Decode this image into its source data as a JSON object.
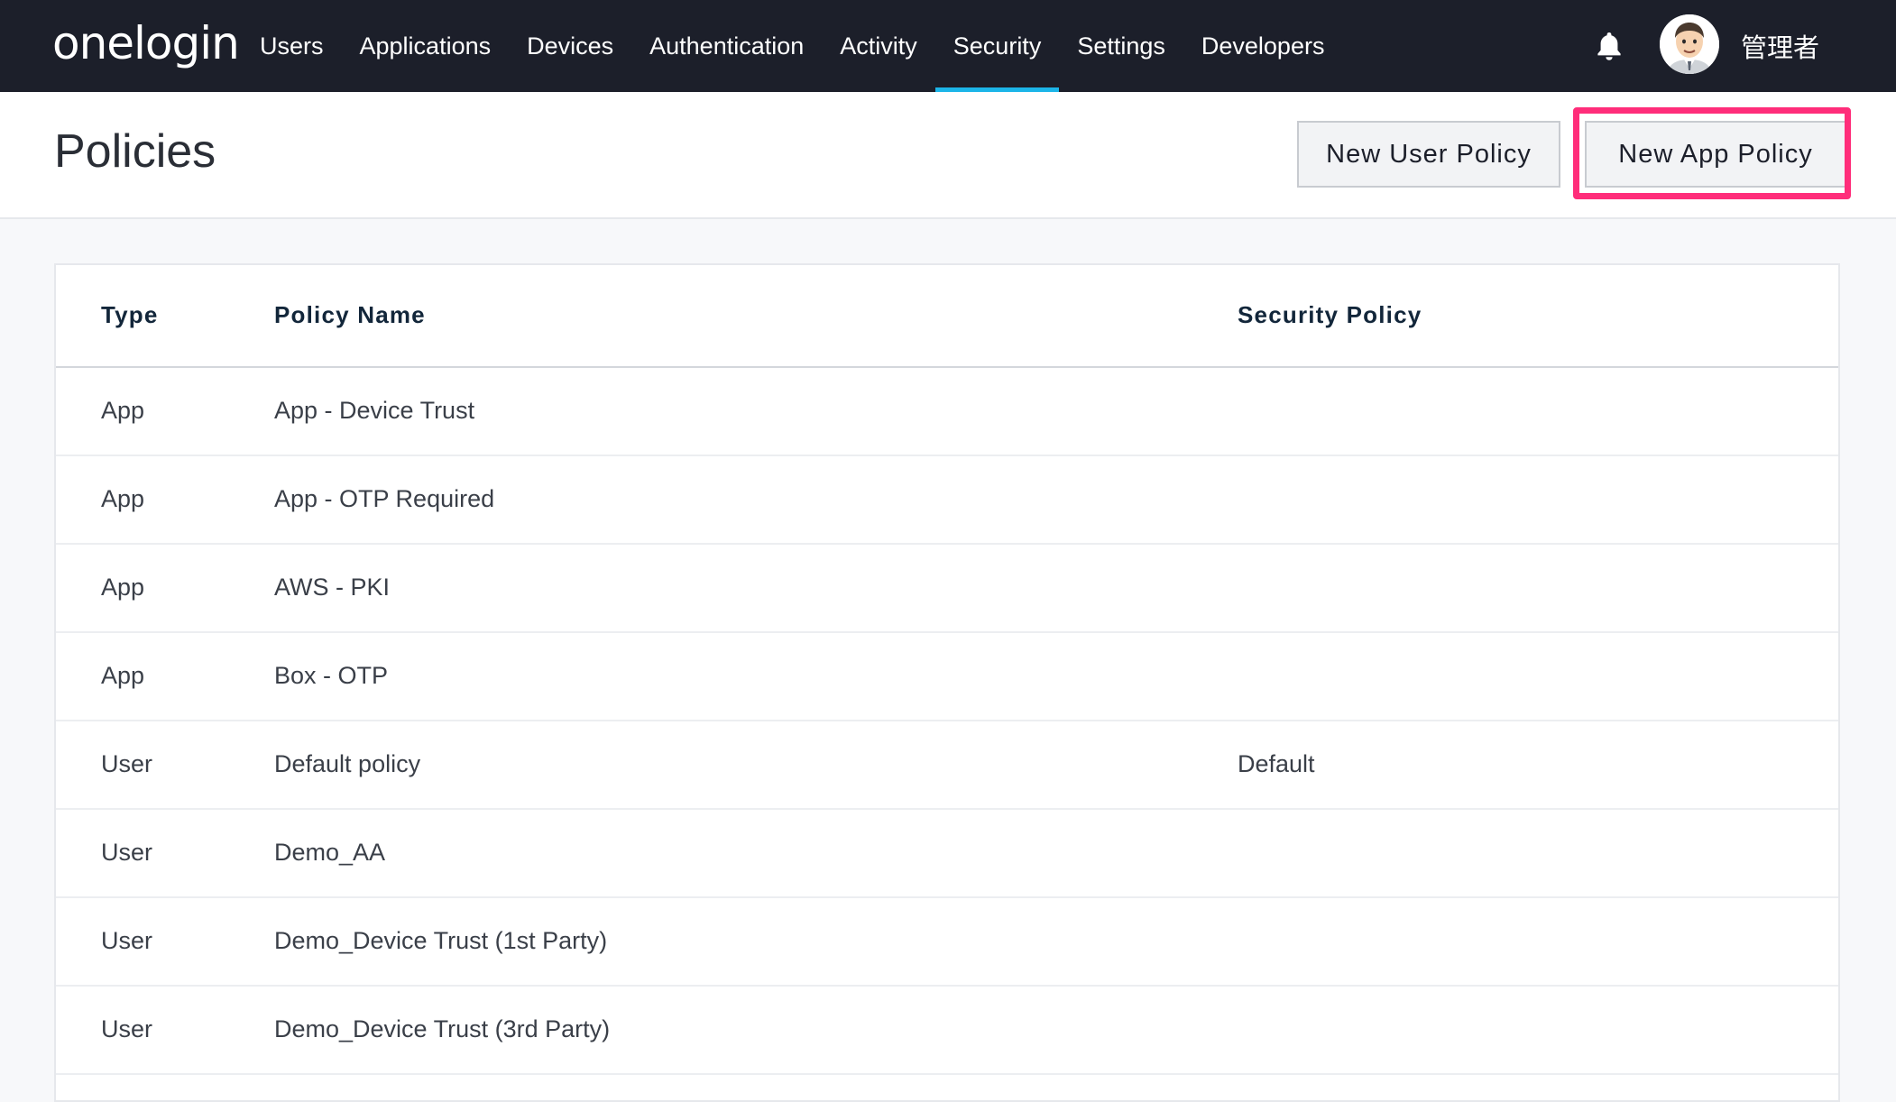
{
  "nav": {
    "logo": "onelogin",
    "items": [
      {
        "label": "Users",
        "active": false
      },
      {
        "label": "Applications",
        "active": false
      },
      {
        "label": "Devices",
        "active": false
      },
      {
        "label": "Authentication",
        "active": false
      },
      {
        "label": "Activity",
        "active": false
      },
      {
        "label": "Security",
        "active": true
      },
      {
        "label": "Settings",
        "active": false
      },
      {
        "label": "Developers",
        "active": false
      }
    ],
    "notification_icon": "bell-icon",
    "user_name": "管理者"
  },
  "header": {
    "title": "Policies",
    "new_user_policy_label": "New User Policy",
    "new_app_policy_label": "New App Policy"
  },
  "table": {
    "columns": {
      "type": "Type",
      "name": "Policy Name",
      "security": "Security Policy"
    },
    "rows": [
      {
        "type": "App",
        "name": "App - Device Trust",
        "security": ""
      },
      {
        "type": "App",
        "name": "App - OTP Required",
        "security": ""
      },
      {
        "type": "App",
        "name": "AWS - PKI",
        "security": ""
      },
      {
        "type": "App",
        "name": "Box - OTP",
        "security": ""
      },
      {
        "type": "User",
        "name": "Default policy",
        "security": "Default"
      },
      {
        "type": "User",
        "name": "Demo_AA",
        "security": ""
      },
      {
        "type": "User",
        "name": "Demo_Device Trust (1st Party)",
        "security": ""
      },
      {
        "type": "User",
        "name": "Demo_Device Trust (3rd Party)",
        "security": ""
      }
    ]
  },
  "colors": {
    "nav_bg": "#1c1f2a",
    "active_underline": "#1cb5e8",
    "highlight_border": "#ff2d7a"
  }
}
